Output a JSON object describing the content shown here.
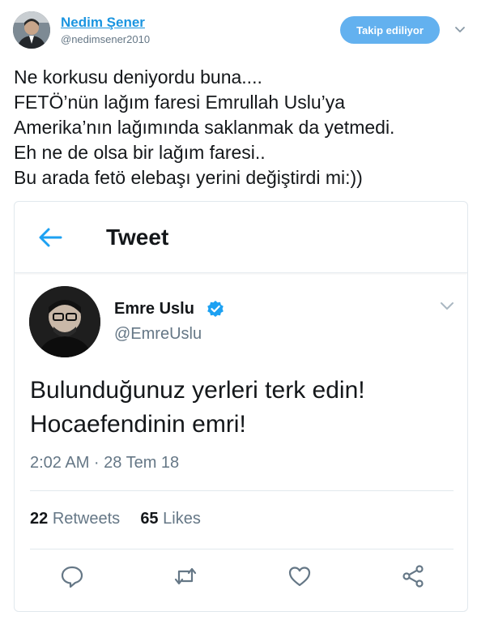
{
  "header": {
    "user_name": "Nedim Şener",
    "user_handle": "@nedimsener2010",
    "follow_label": "Takip ediliyor"
  },
  "tweet": {
    "lines": [
      "Ne korkusu deniyordu buna....",
      "FETÖ’nün lağım faresi Emrullah Uslu’ya",
      "Amerika’nın lağımında saklanmak da yetmedi.",
      "Eh ne de olsa bir lağım faresi..",
      "Bu arada fetö elebaşı yerini değiştirdi mi:))"
    ]
  },
  "embed": {
    "title": "Tweet",
    "user_name": "Emre Uslu",
    "user_handle": "@EmreUslu",
    "lines": [
      "Bulunduğunuz yerleri terk edin!",
      "Hocaefendinin emri!"
    ],
    "timestamp": "2:02 AM · 28 Tem 18",
    "retweets_count": "22",
    "retweets_label": "Retweets",
    "likes_count": "65",
    "likes_label": "Likes"
  },
  "colors": {
    "link_blue": "#1b95e0",
    "follow_button": "#63b1ef",
    "muted_gray": "#657786",
    "icon_gray": "#657786"
  },
  "icons": [
    "chevron-down-icon",
    "back-arrow-icon",
    "verified-badge-icon",
    "reply-icon",
    "retweet-icon",
    "like-icon",
    "share-icon"
  ]
}
